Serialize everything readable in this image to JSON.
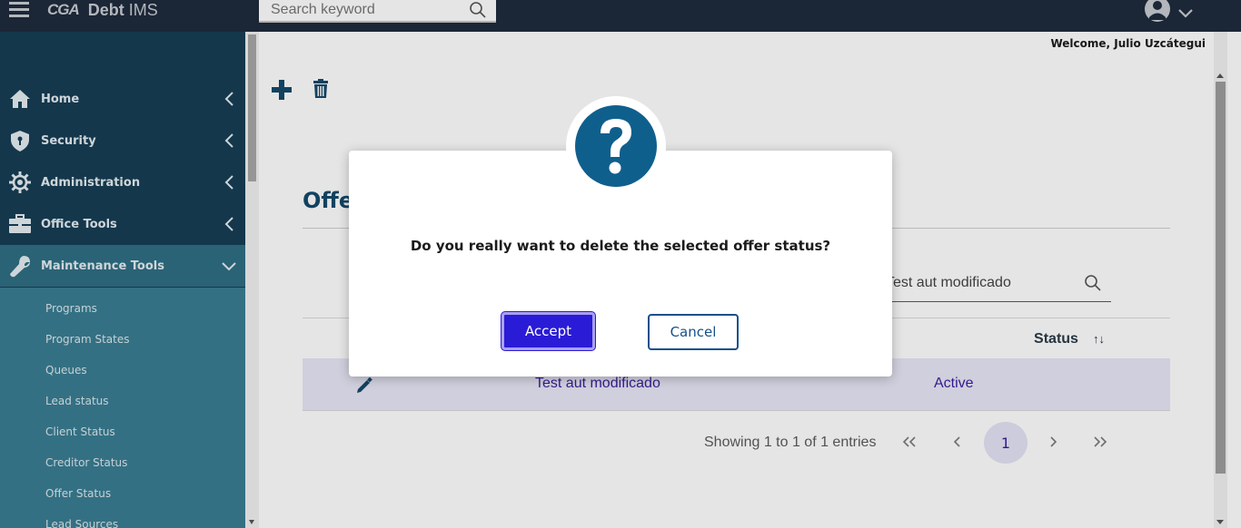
{
  "app": {
    "logo_mark": "CGA",
    "title_bold": "Debt",
    "title_rest": " IMS"
  },
  "header": {
    "search_placeholder": "Search keyword",
    "welcome": "Welcome, Julio Uzcátegui"
  },
  "sidebar": {
    "items": [
      {
        "label": "Home",
        "icon": "home-icon"
      },
      {
        "label": "Security",
        "icon": "shield-icon"
      },
      {
        "label": "Administration",
        "icon": "gear-icon"
      },
      {
        "label": "Office Tools",
        "icon": "briefcase-icon"
      },
      {
        "label": "Maintenance Tools",
        "icon": "wrench-icon",
        "expanded": true
      }
    ],
    "subitems": [
      "Programs",
      "Program States",
      "Queues",
      "Lead status",
      "Client Status",
      "Creditor Status",
      "Offer Status",
      "Lead Sources"
    ]
  },
  "main": {
    "heading_partial": "Offe",
    "table_search_value": "Test aut modificado",
    "columns": {
      "status": "Status",
      "sort_icon": "↑↓"
    },
    "rows": [
      {
        "name": "Test aut modificado",
        "status": "Active"
      }
    ],
    "pager": {
      "info": "Showing 1 to 1 of 1 entries",
      "first": "«",
      "prev": "‹",
      "current": "1",
      "next": "›",
      "last": "»"
    }
  },
  "modal": {
    "message": "Do you really want to delete the selected offer status?",
    "accept_label": "Accept",
    "cancel_label": "Cancel",
    "icon": "question-icon"
  },
  "colors": {
    "topbar": "#1f2b3d",
    "sidebar": "#173e55",
    "submenu": "#3a7d92",
    "accent": "#2a1bd6",
    "brand_blue": "#0f5f8d"
  }
}
